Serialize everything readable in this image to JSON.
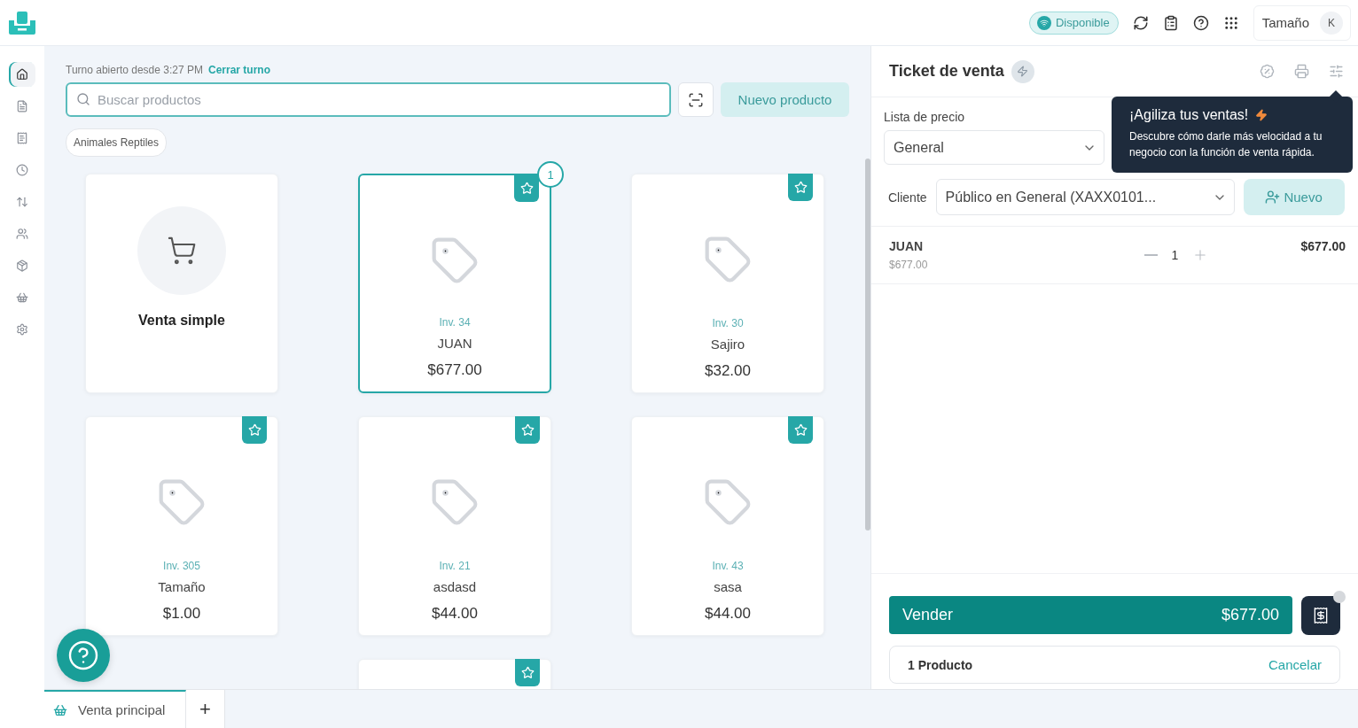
{
  "header": {
    "status": "Disponible",
    "account": "Tamaño",
    "avatar": "K"
  },
  "nav": [
    {
      "selected": true
    },
    {
      "selected": false
    },
    {
      "selected": false
    },
    {
      "selected": false
    },
    {
      "selected": false
    },
    {
      "selected": false
    },
    {
      "selected": false
    },
    {
      "selected": false
    },
    {
      "selected": false
    }
  ],
  "shift": {
    "text": "Turno abierto desde 3:27 PM",
    "link": "Cerrar turno"
  },
  "search": {
    "placeholder": "Buscar productos"
  },
  "new_product": "Nuevo producto",
  "categories": [
    {
      "label": "Animales Reptiles"
    }
  ],
  "products": [
    {
      "kind": "simple",
      "name": "Venta simple"
    },
    {
      "kind": "product",
      "inventory": "Inv. 34",
      "name": "JUAN",
      "price": "$677.00",
      "selected": true,
      "count": "1"
    },
    {
      "kind": "product",
      "inventory": "Inv. 30",
      "name": "Sajiro",
      "price": "$32.00",
      "selected": false
    },
    {
      "kind": "product",
      "inventory": "Inv. 305",
      "name": "Tamaño",
      "price": "$1.00",
      "selected": false
    },
    {
      "kind": "product",
      "inventory": "Inv. 21",
      "name": "asdasd",
      "price": "$44.00",
      "selected": false
    },
    {
      "kind": "product",
      "inventory": "Inv. 43",
      "name": "sasa",
      "price": "$44.00",
      "selected": false
    },
    {
      "kind": "empty"
    },
    {
      "kind": "partial"
    }
  ],
  "ticket": {
    "title": "Ticket de venta",
    "price_list_label": "Lista de precio",
    "price_list": "General",
    "client_label": "Cliente",
    "client": "Público en General (XAXX0101...",
    "new_client": "Nuevo",
    "items": [
      {
        "name": "JUAN",
        "unit_price": "$677.00",
        "quantity": "1",
        "total": "$677.00"
      }
    ],
    "sell": "Vender",
    "total": "$677.00",
    "summary": "1 Producto",
    "cancel": "Cancelar"
  },
  "tooltip": {
    "title": "¡Agiliza tus ventas!",
    "body": "Descubre cómo darle más velocidad a tu negocio con la función de venta rápida."
  },
  "tabs": [
    {
      "label": "Venta principal",
      "selected": true
    }
  ],
  "add_tab": "+"
}
